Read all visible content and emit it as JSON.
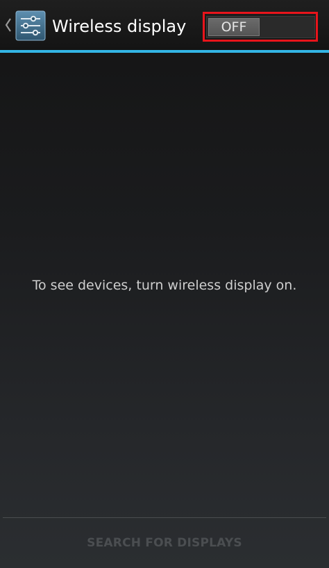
{
  "action_bar": {
    "title": "Wireless display",
    "back_icon": "chevron-left-icon",
    "app_icon": "settings-sliders-icon",
    "accent_color": "#33b5e5"
  },
  "wireless_toggle": {
    "label": "OFF",
    "state": "off",
    "highlight_color": "#e8141b"
  },
  "main": {
    "empty_message": "To see devices, turn wireless display on."
  },
  "footer": {
    "search_button_label": "SEARCH FOR DISPLAYS",
    "search_button_enabled": false
  }
}
